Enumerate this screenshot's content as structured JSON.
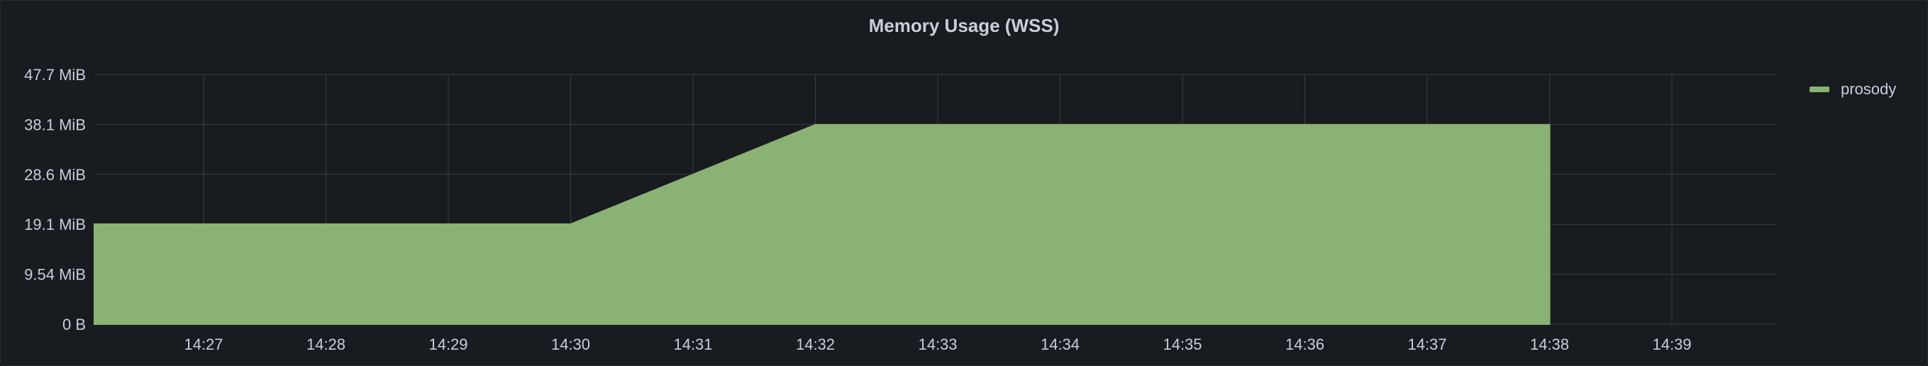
{
  "panel": {
    "title": "Memory Usage (WSS)"
  },
  "colors": {
    "series": "#8ab274",
    "grid": "#3a3d44",
    "text": "#ccccdc",
    "background": "#181b1f"
  },
  "chart_data": {
    "type": "area",
    "title": "Memory Usage (WSS)",
    "x_tick_labels": [
      "14:27",
      "14:28",
      "14:29",
      "14:30",
      "14:31",
      "14:32",
      "14:33",
      "14:34",
      "14:35",
      "14:36",
      "14:37",
      "14:38",
      "14:39"
    ],
    "y_tick_labels": [
      "0 B",
      "9.54 MiB",
      "19.1 MiB",
      "28.6 MiB",
      "38.1 MiB",
      "47.7 MiB"
    ],
    "ylim": [
      0,
      47.7
    ],
    "y_unit": "MiB",
    "grid": true,
    "legend_placement": "right",
    "series": [
      {
        "name": "prosody",
        "x": [
          "14:26:06",
          "14:30",
          "14:32",
          "14:38"
        ],
        "values": [
          19.1,
          19.1,
          38.1,
          38.1
        ]
      }
    ]
  }
}
